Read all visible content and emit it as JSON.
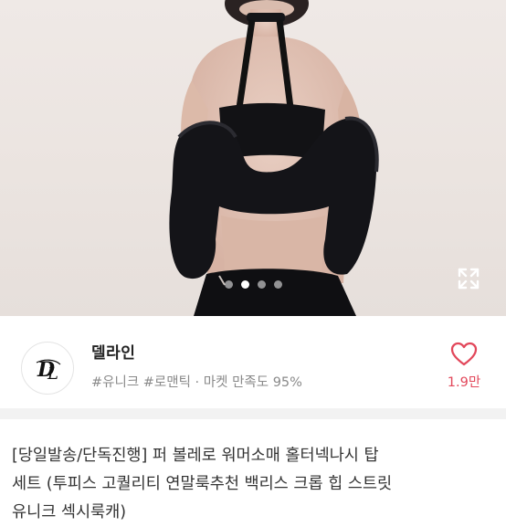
{
  "carousel": {
    "slide_count": 4,
    "active_index": 1,
    "expand_icon": "expand-arrows-icon",
    "image_alt": "Model wearing black fur bolero with halter neck top, seen from the back"
  },
  "store": {
    "name": "델라인",
    "logo_text": "DL",
    "tags": "#유니크 #로맨틱 · 마켓 만족도 95%",
    "like_icon": "heart-outline-icon",
    "like_count": "1.9만"
  },
  "colors": {
    "accent": "#e2485b",
    "tag_text": "#8a8a8a",
    "divider": "#f2f2f2"
  },
  "product": {
    "title_lines": [
      "[당일발송/단독진행] 퍼 볼레로 워머소매 홀터넥나시 탑",
      "세트 (투피스 고퀄리티 연말룩추천 백리스 크롭 힙 스트릿",
      "유니크 섹시룩캐)"
    ]
  }
}
